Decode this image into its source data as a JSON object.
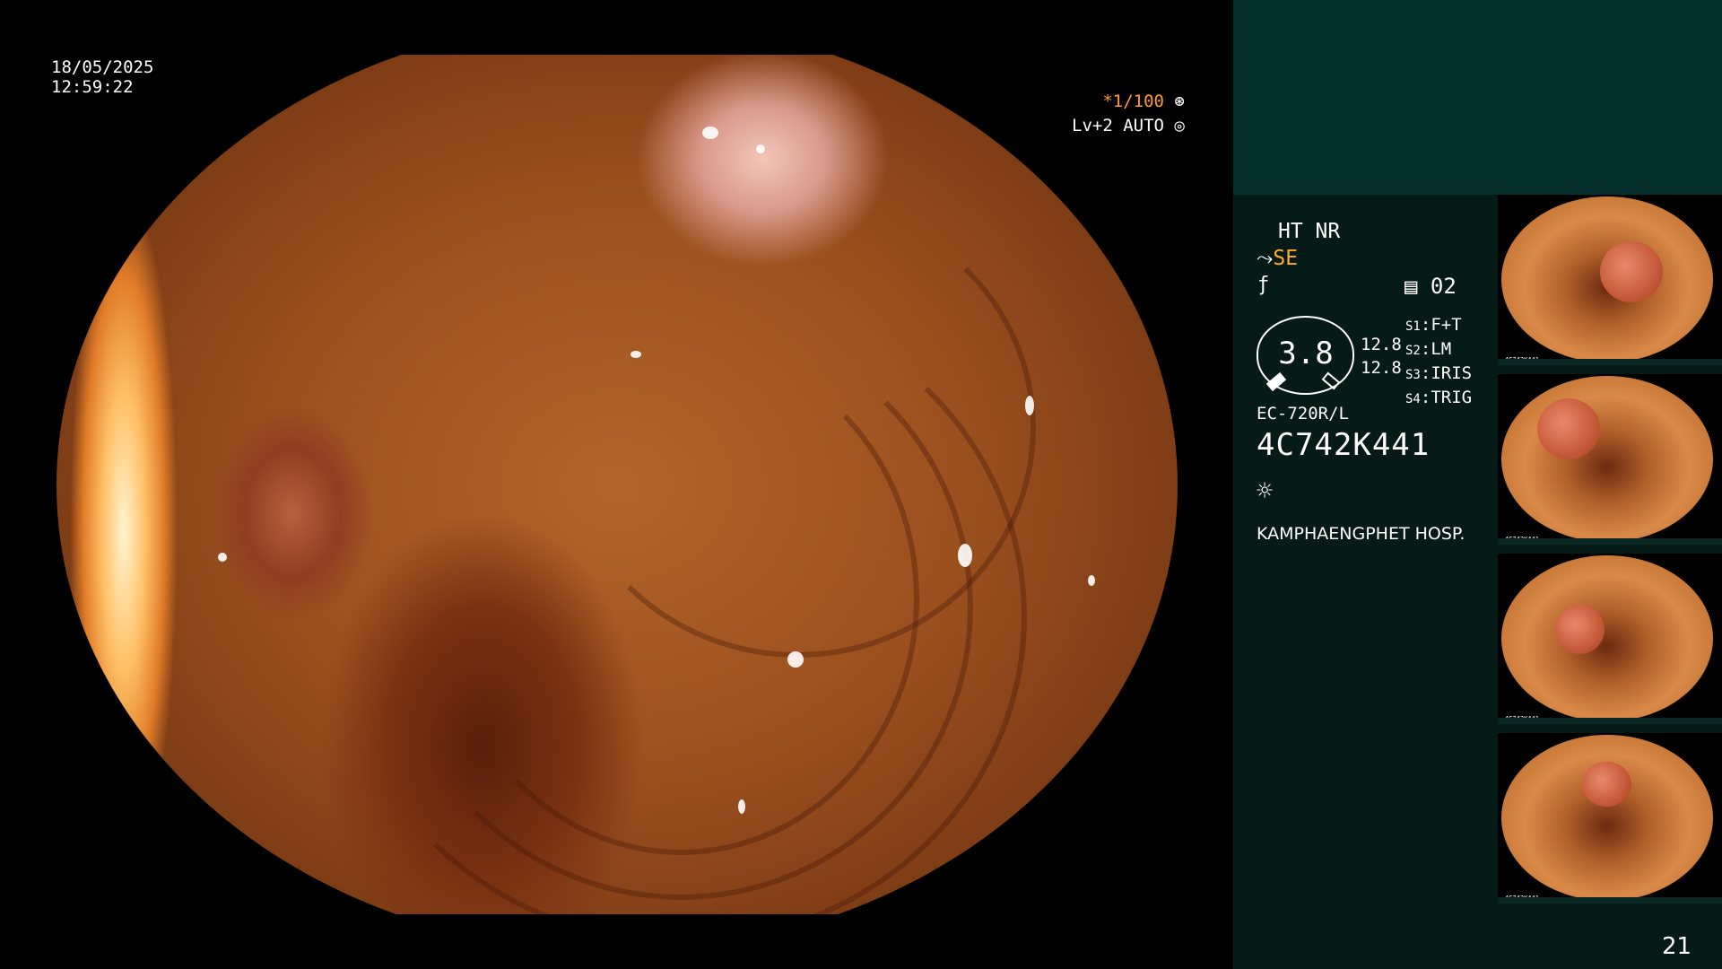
{
  "overlay": {
    "date": "18/05/2025",
    "time": "12:59:22",
    "magnification": "*1/100",
    "level": "Lv+2 AUTO"
  },
  "panel": {
    "ht_nr": "HT NR",
    "se": "SE",
    "rec_count": "02",
    "gauge_value": "3.8",
    "side_values": [
      "12.8",
      "12.8"
    ],
    "s_items": [
      {
        "key": "S1",
        "val": "F+T"
      },
      {
        "key": "S2",
        "val": "LM"
      },
      {
        "key": "S3",
        "val": "IRIS"
      },
      {
        "key": "S4",
        "val": "TRIG"
      }
    ],
    "scope_model": "EC-720R/L",
    "serial": "4C742K441",
    "hospital": "KAMPHAENGPHET HOSP.",
    "page_number": "21"
  },
  "thumbnails": [
    {
      "serial": "4C742K441"
    },
    {
      "serial": "4C742K441"
    },
    {
      "serial": "4C742K441"
    },
    {
      "serial": "4C742K441"
    }
  ],
  "colors": {
    "accent_orange": "#ffae22",
    "mag_orange": "#ff9a2e",
    "panel_bg": "#061a17",
    "panel_top": "#06302c"
  }
}
